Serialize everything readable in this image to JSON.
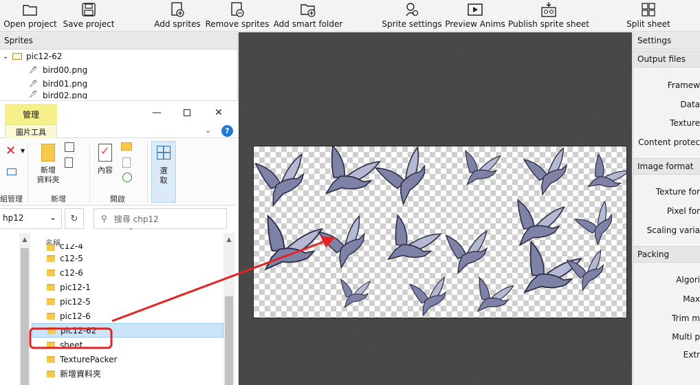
{
  "toolbar": {
    "open_project": "Open project",
    "save_project": "Save project",
    "add_sprites": "Add sprites",
    "remove_sprites": "Remove sprites",
    "add_smart_folder": "Add smart folder",
    "sprite_settings": "Sprite settings",
    "preview_anims": "Preview Anims",
    "publish_sprite_sheet": "Publish sprite sheet",
    "split_sheet": "Split sheet"
  },
  "sprites_panel": {
    "title": "Sprites",
    "folder": "pic12-62",
    "files": [
      "bird00.png",
      "bird01.png",
      "bird02.png"
    ]
  },
  "explorer": {
    "context_tab": "管理",
    "picture_tools_tab": "圖片工具",
    "help": "?",
    "ribbon": {
      "new_folder": "新增\n資料夾",
      "properties": "內容",
      "select": "選\n取",
      "group_manage": "組管理",
      "group_new": "新增",
      "group_open": "開啟"
    },
    "address": "hp12",
    "search_placeholder": "搜尋 chp12",
    "column_name": "名稱",
    "files": [
      "c12-4",
      "c12-5",
      "c12-6",
      "pic12-1",
      "pic12-5",
      "pic12-6",
      "pic12-62",
      "sheet",
      "TexturePacker",
      "新增資料夾"
    ],
    "selected": "pic12-62"
  },
  "settings": {
    "title": "Settings",
    "output_files": "Output files",
    "framework": "Framew",
    "data": "Data",
    "texture": "Texture",
    "content_protection": "Content protec",
    "image_format": "Image format",
    "texture_format": "Texture for",
    "pixel_format": "Pixel for",
    "scaling_variants": "Scaling varia",
    "packing": "Packing",
    "algorithm": "Algori",
    "max_size": "Max",
    "trim_mode": "Trim m",
    "multipack": "Multi p",
    "extrude": "Extr"
  },
  "colors": {
    "canvas_bg": "#474747",
    "annotation_red": "#e52222",
    "selected_row": "#cce4f7",
    "context_tab": "#f6f08a",
    "bird": "#7e82a6"
  }
}
